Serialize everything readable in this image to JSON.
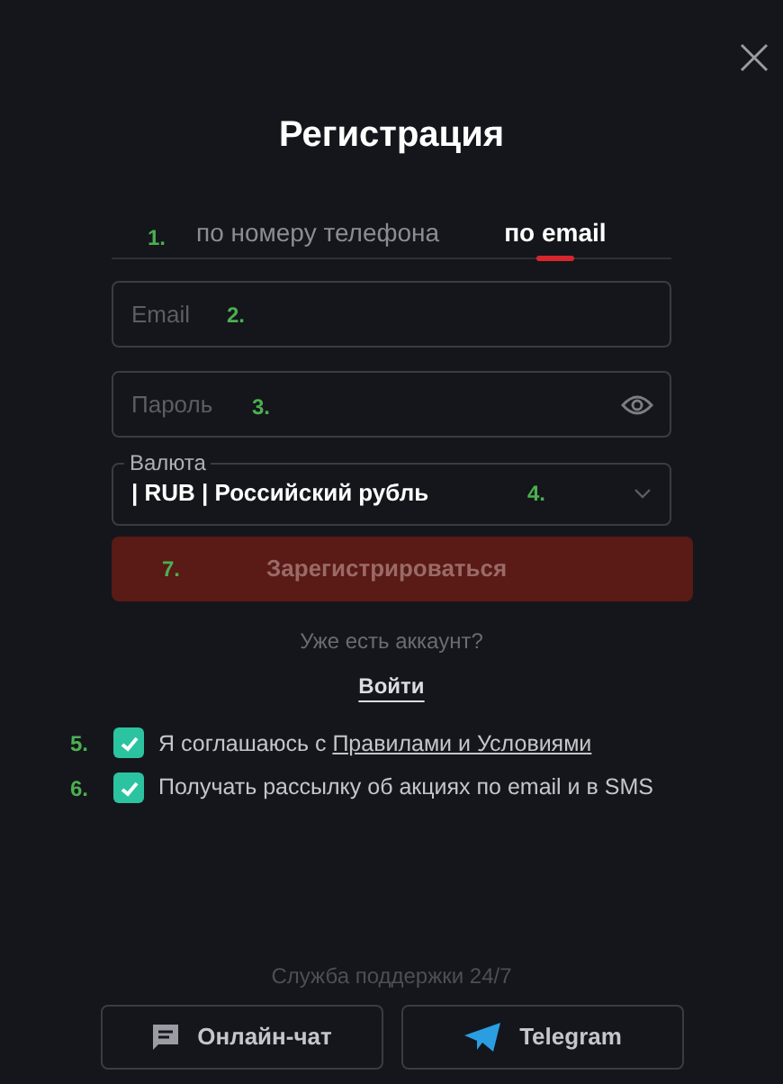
{
  "title": "Регистрация",
  "tabs_note": "1.",
  "tabs": [
    {
      "label": "по номеру телефона",
      "selected": false
    },
    {
      "label": "по email",
      "selected": true
    }
  ],
  "email": {
    "placeholder": "Email",
    "note": "2."
  },
  "password": {
    "placeholder": "Пароль",
    "note": "3."
  },
  "currency": {
    "label": "Валюта",
    "value": "| RUB | Российский рубль",
    "note": "4."
  },
  "register": {
    "label": "Зарегистрироваться",
    "note": "7.",
    "disabled": true
  },
  "have_account": "Уже есть аккаунт?",
  "login": "Войти",
  "checks": [
    {
      "note": "5.",
      "checked": true,
      "text": "Я соглашаюсь с ",
      "link": "Правилами и Условиями"
    },
    {
      "note": "6.",
      "checked": true,
      "text": "Получать рассылку об акциях по email и в SMS"
    }
  ],
  "support": "Служба поддержки 24/7",
  "buttons": [
    {
      "kind": "chat",
      "label": "Онлайн-чат"
    },
    {
      "kind": "telegram",
      "label": "Telegram"
    }
  ]
}
